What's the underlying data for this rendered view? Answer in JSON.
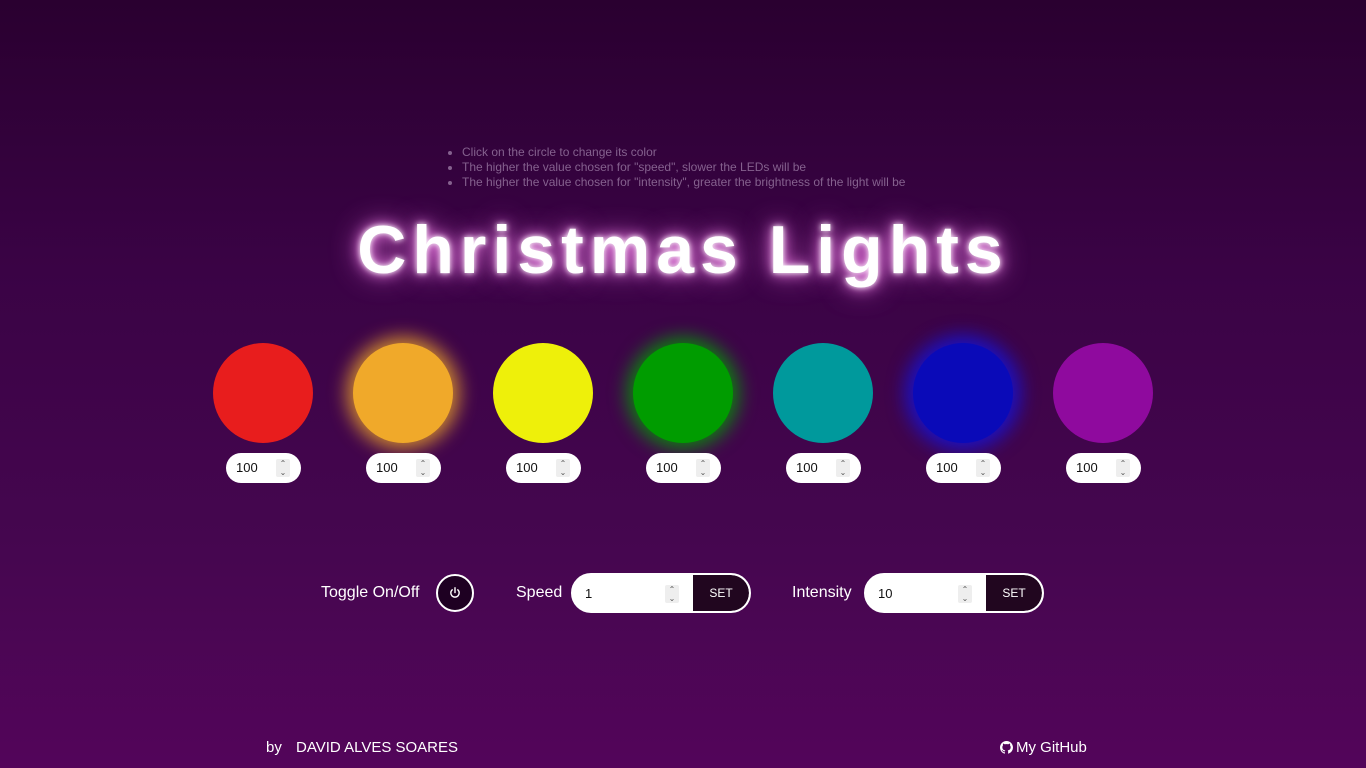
{
  "instructions": [
    "Click on the circle to change its color",
    "The higher the value chosen for \"speed\", slower the LEDs will be",
    "The higher the value chosen for \"intensity\", greater the brightness of the light will be"
  ],
  "title": "Christmas Lights",
  "lights": [
    {
      "color": "#e81d1d",
      "value": "100"
    },
    {
      "color": "#f0a92a",
      "value": "100"
    },
    {
      "color": "#eef00a",
      "value": "100"
    },
    {
      "color": "#009c00",
      "value": "100"
    },
    {
      "color": "#00999c",
      "value": "100"
    },
    {
      "color": "#0a0ab8",
      "value": "100"
    },
    {
      "color": "#8f0a9e",
      "value": "100"
    }
  ],
  "controls": {
    "toggle_label": "Toggle On/Off",
    "speed_label": "Speed",
    "speed_value": "1",
    "speed_set": "SET",
    "intensity_label": "Intensity",
    "intensity_value": "10",
    "intensity_set": "SET"
  },
  "footer": {
    "by": "by",
    "author": "DAVID ALVES SOARES",
    "github": "My GitHub"
  },
  "icons": {
    "power": "power-icon",
    "github": "github-icon",
    "spin_up": "chevron-up-icon",
    "spin_down": "chevron-down-icon"
  }
}
